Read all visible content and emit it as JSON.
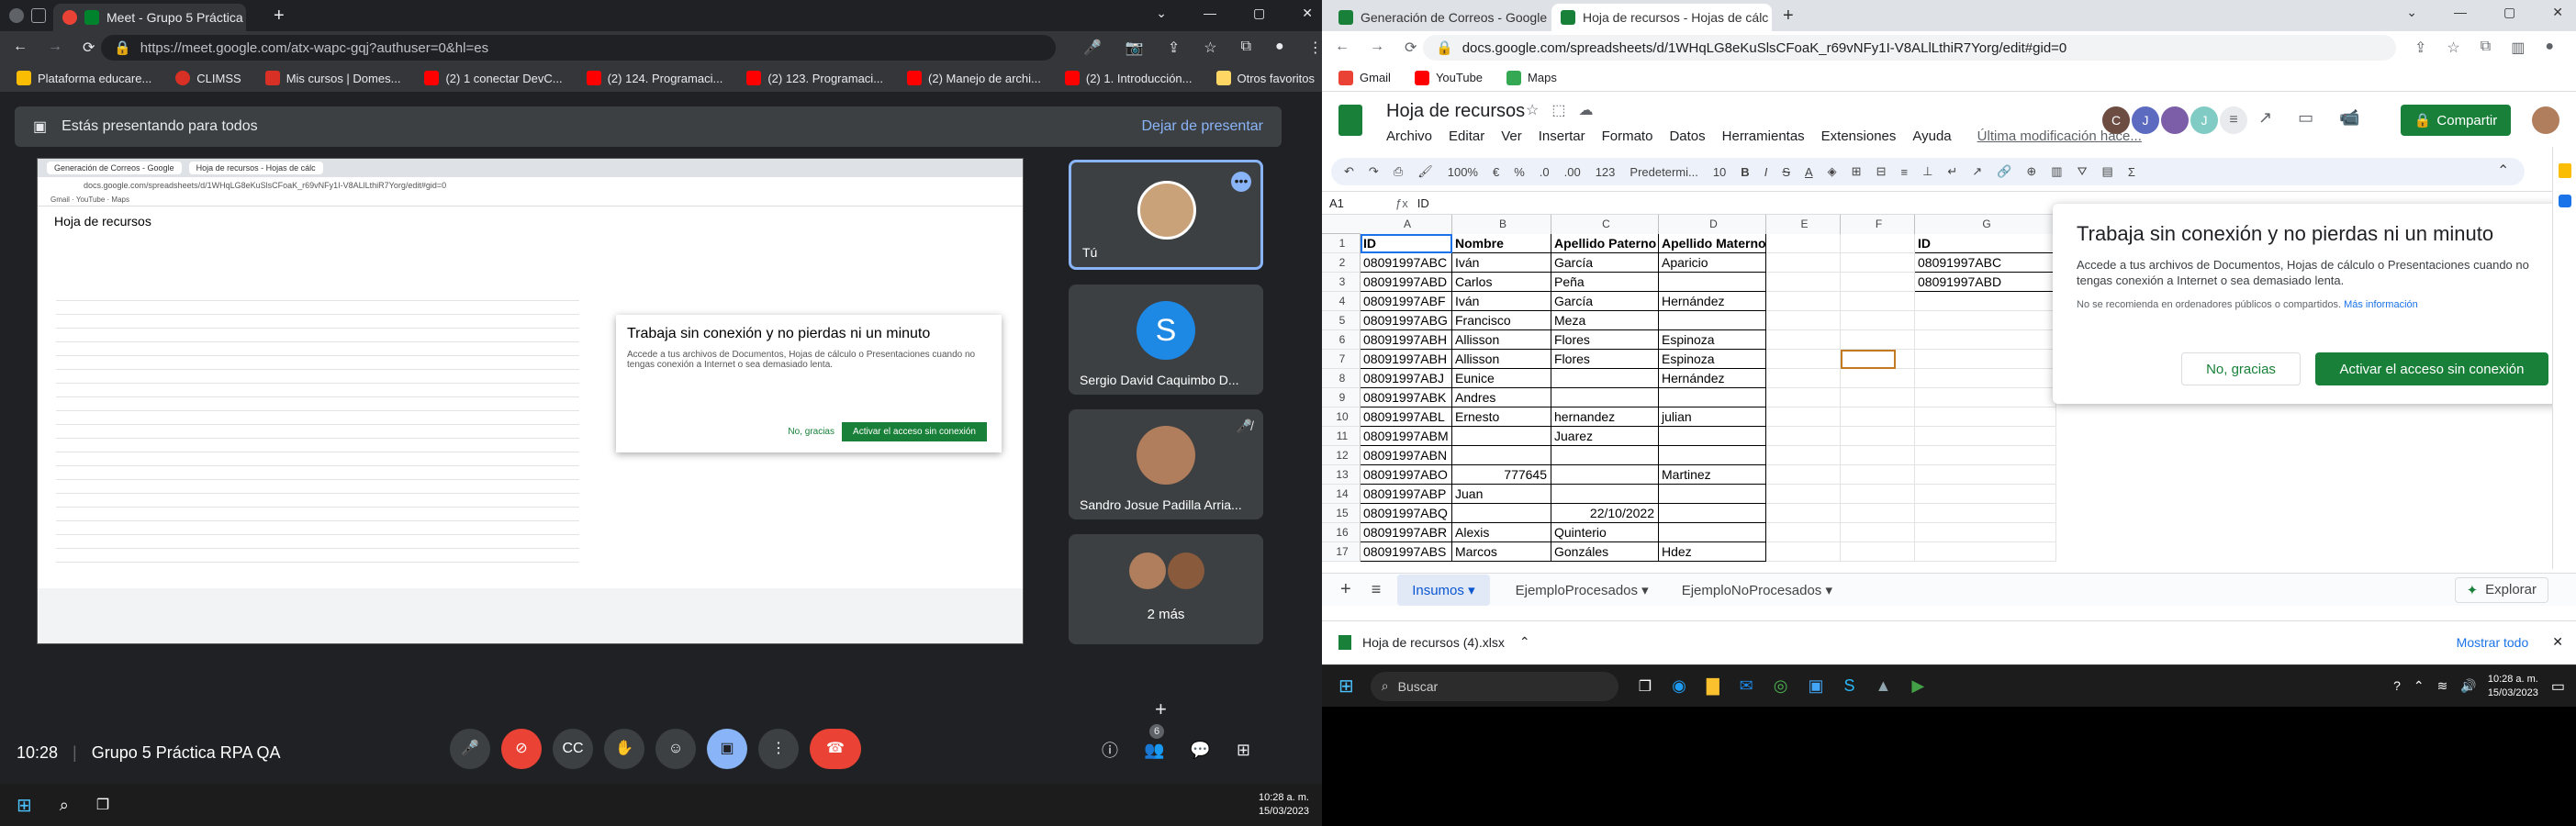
{
  "left_browser": {
    "tabs": [
      "Meet - Grupo 5 Práctica RPA"
    ],
    "url": "https://meet.google.com/atx-wapc-gqj?authuser=0&hl=es",
    "bookmarks": [
      "Plataforma educare...",
      "CLIMSS",
      "Mis cursos | Domes...",
      "(2) 1 conectar DevC...",
      "(2) 124. Programaci...",
      "(2) 123. Programaci...",
      "(2) Manejo de archi...",
      "(2) 1. Introducción..."
    ],
    "other_bookmarks": "Otros favoritos"
  },
  "meet": {
    "presenting_text": "Estás presentando para todos",
    "stop_presenting": "Dejar de presentar",
    "time": "10:28",
    "meeting_name": "Grupo 5 Práctica RPA QA",
    "participants": [
      {
        "name": "Tú",
        "avatar": "photo"
      },
      {
        "name": "Sergio David Caquimbo D...",
        "avatar": "S"
      },
      {
        "name": "Sandro Josue Padilla Arria...",
        "avatar": "photo"
      },
      {
        "name": "2 más",
        "avatar": "group"
      }
    ],
    "people_count": "6"
  },
  "right_browser": {
    "tabs": [
      "Generación de Correos - Google",
      "Hoja de recursos - Hojas de cálc"
    ],
    "url": "docs.google.com/spreadsheets/d/1WHqLG8eKuSlsCFoaK_r69vNFy1I-V8ALlLthiR7Yorg/edit#gid=0",
    "bookmarks": [
      "Gmail",
      "YouTube",
      "Maps"
    ]
  },
  "sheet": {
    "title": "Hoja de recursos",
    "menu": [
      "Archivo",
      "Editar",
      "Ver",
      "Insertar",
      "Formato",
      "Datos",
      "Herramientas",
      "Extensiones",
      "Ayuda"
    ],
    "last_edit": "Última modificación hace...",
    "share_label": "Compartir",
    "zoom": "100%",
    "font": "Predetermi...",
    "font_size": "10",
    "cell_ref": "A1",
    "formula": "ID",
    "col_headers": [
      "A",
      "B",
      "C",
      "D",
      "E",
      "F",
      "G"
    ],
    "rows": [
      [
        "ID",
        "Nombre",
        "Apellido Paterno",
        "Apellido Materno",
        "",
        "",
        "ID"
      ],
      [
        "08091997ABC",
        "Iván",
        "García",
        "Aparicio",
        "",
        "",
        "08091997ABC"
      ],
      [
        "08091997ABD",
        "Carlos",
        "Peña",
        "",
        "",
        "",
        "08091997ABD"
      ],
      [
        "08091997ABF",
        "Iván",
        "García",
        "Hernández",
        "",
        "",
        ""
      ],
      [
        "08091997ABG",
        "Francisco",
        "Meza",
        "",
        "",
        "",
        ""
      ],
      [
        "08091997ABH",
        "Allisson",
        "Flores",
        "Espinoza",
        "",
        "",
        ""
      ],
      [
        "08091997ABH",
        "Allisson",
        "Flores",
        "Espinoza",
        "",
        "",
        ""
      ],
      [
        "08091997ABJ",
        "Eunice",
        "",
        "Hernández",
        "",
        "",
        ""
      ],
      [
        "08091997ABK",
        "Andres",
        "",
        "",
        "",
        "",
        ""
      ],
      [
        "08091997ABL",
        "Ernesto",
        "hernandez",
        "julian",
        "",
        "",
        ""
      ],
      [
        "08091997ABM",
        "",
        "Juarez",
        "",
        "",
        "",
        ""
      ],
      [
        "08091997ABN",
        "",
        "",
        "",
        "",
        "",
        ""
      ],
      [
        "08091997ABO",
        "777645",
        "",
        "Martinez",
        "",
        "",
        ""
      ],
      [
        "08091997ABP",
        "Juan",
        "",
        "",
        "",
        "",
        ""
      ],
      [
        "08091997ABQ",
        "",
        "22/10/2022",
        "",
        "",
        "",
        ""
      ],
      [
        "08091997ABR",
        "Alexis",
        "Quinterio",
        "",
        "",
        "",
        ""
      ],
      [
        "08091997ABS",
        "Marcos",
        "Gonzáles",
        "Hdez",
        "",
        "",
        ""
      ]
    ],
    "sheet_tabs": [
      "Insumos",
      "EjemploProcesados",
      "EjemploNoProcesados"
    ],
    "explore": "Explorar",
    "offline_title": "Trabaja sin conexión y no pierdas ni un minuto",
    "offline_text": "Accede a tus archivos de Documentos, Hojas de cálculo o Presentaciones cuando no tengas conexión a Internet o sea demasiado lenta.",
    "offline_note": "No se recomienda en ordenadores públicos o compartidos.",
    "offline_link": "Más información",
    "offline_no": "No, gracias",
    "offline_yes": "Activar el acceso sin conexión"
  },
  "download": {
    "file": "Hoja de recursos (4).xlsx",
    "show_all": "Mostrar todo"
  },
  "taskbar": {
    "search": "Buscar",
    "time": "10:28 a. m.",
    "date": "15/03/2023"
  },
  "colors": {
    "sheets_green": "#188038",
    "meet_red": "#ea4335",
    "accent_blue": "#8ab4f8"
  }
}
